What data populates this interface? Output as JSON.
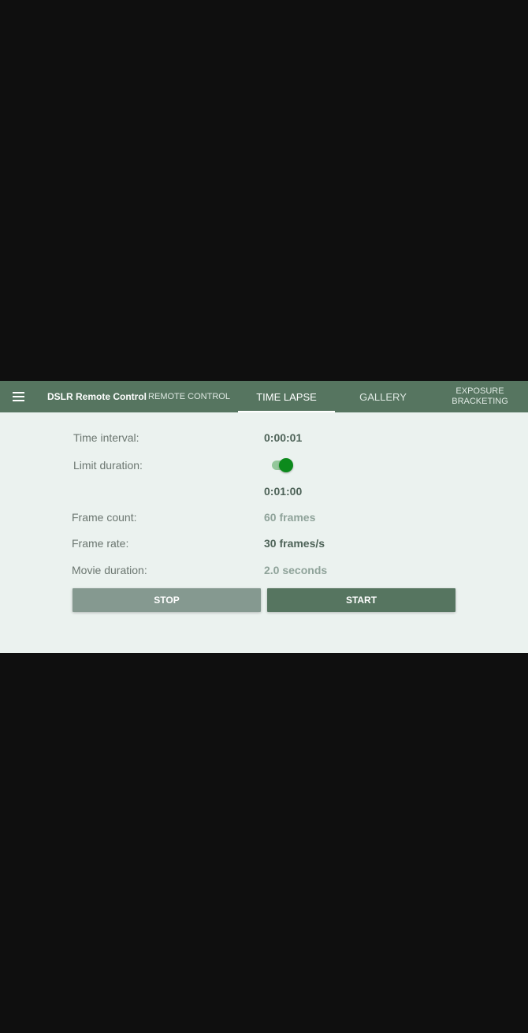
{
  "toolbar": {
    "menu_icon": "hamburger-menu-icon",
    "title": "DSLR Remote Control",
    "tabs": [
      {
        "label": "REMOTE CONTROL",
        "active": false
      },
      {
        "label": "TIME LAPSE",
        "active": true
      },
      {
        "label": "GALLERY",
        "active": false
      },
      {
        "label": "EXPOSURE\nBRACKETING",
        "active": false
      }
    ]
  },
  "timelapse": {
    "time_interval_label": "Time interval:",
    "time_interval_value": "0:00:01",
    "limit_duration_label": "Limit duration:",
    "limit_duration_on": true,
    "duration_value": "0:01:00",
    "frame_count_label": "Frame count:",
    "frame_count_value": "60 frames",
    "frame_rate_label": "Frame rate:",
    "frame_rate_value": "30 frames/s",
    "movie_duration_label": "Movie duration:",
    "movie_duration_value": "2.0 seconds"
  },
  "buttons": {
    "stop_label": "STOP",
    "start_label": "START"
  },
  "colors": {
    "toolbar": "#567560",
    "background": "#ebf2ef",
    "accent": "#0c8a1c"
  }
}
